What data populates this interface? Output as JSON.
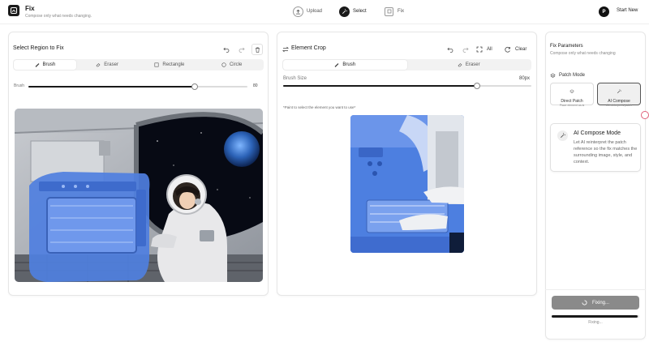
{
  "header": {
    "app_title": "Fix",
    "app_subtitle": "Compose only what needs changing.",
    "steps": [
      {
        "label": "Upload",
        "icon": "upload-icon"
      },
      {
        "label": "Select",
        "icon": "wand-icon"
      },
      {
        "label": "Fix",
        "icon": "fix-icon"
      }
    ],
    "avatar_initial": "P",
    "start_new": "Start New"
  },
  "left_panel": {
    "title": "Select Region to Fix",
    "tools": [
      "Brush",
      "Eraser",
      "Rectangle",
      "Circle"
    ],
    "active_tool": "Brush",
    "slider_label": "Brush",
    "slider_value": "80",
    "slider_fraction": 0.76
  },
  "middle_panel": {
    "title": "Element Crop",
    "all_label": "All",
    "clear_label": "Clear",
    "tools": [
      "Brush",
      "Eraser"
    ],
    "active_tool": "Brush",
    "slider_label": "Brush Size",
    "slider_value": "80px",
    "slider_fraction": 0.76,
    "hint": "*Paint to select the element you want to use*"
  },
  "right_panel": {
    "title": "Fix Parameters",
    "subtitle": "Compose only what needs changing",
    "patch_mode_label": "Patch Mode",
    "modes": [
      {
        "title": "Direct Patch",
        "sub": "Place element as-is"
      },
      {
        "title": "AI Compose",
        "sub": "AI reinterprets patch"
      }
    ],
    "active_mode": "AI Compose",
    "info_title": "AI Compose Mode",
    "info_text": "Let AI reinterpret the patch reference so the fix matches the surrounding image, style, and context.",
    "fix_button": "Fixing...",
    "progress_fraction": 0.98,
    "progress_label": "Fixing..."
  },
  "colors": {
    "accent": "#1a1a1a",
    "mask_blue": "#4f7fe0",
    "button_disabled": "#8a8a8a"
  }
}
